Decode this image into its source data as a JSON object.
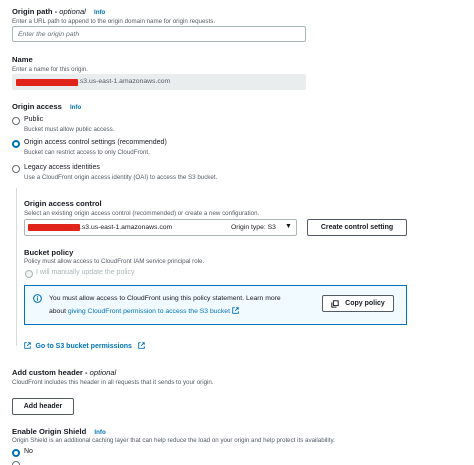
{
  "origin_path": {
    "label": "Origin path",
    "optional": "optional",
    "info": "Info",
    "description": "Enter a URL path to append to the origin domain name for origin requests.",
    "placeholder": "Enter the origin path"
  },
  "name": {
    "label": "Name",
    "description": "Enter a name for this origin.",
    "value_suffix": ".s3.us-east-1.amazonaws.com"
  },
  "origin_access": {
    "label": "Origin access",
    "info": "Info",
    "options": [
      {
        "label": "Public",
        "description": "Bucket must allow public access.",
        "selected": false
      },
      {
        "label": "Origin access control settings (recommended)",
        "description": "Bucket can restrict access to only CloudFront.",
        "selected": true
      },
      {
        "label": "Legacy access identities",
        "description": "Use a CloudFront origin access identity (OAI) to access the S3 bucket.",
        "selected": false
      }
    ]
  },
  "oac": {
    "label": "Origin access control",
    "description": "Select an existing origin access control (recommended) or create a new configuration.",
    "value_suffix": ".s3.us-east-1.amazonaws.com",
    "origin_type": "Origin type: S3",
    "create_button": "Create control setting"
  },
  "bucket_policy": {
    "label": "Bucket policy",
    "description": "Policy must allow access to CloudFront IAM service principal role.",
    "manual_option": "I will manually update the policy"
  },
  "alert": {
    "text_line1": "You must allow access to CloudFront using this policy statement. Learn more",
    "text_prefix": "about",
    "link_text": "giving CloudFront permission to access the S3 bucket",
    "copy_button": "Copy policy"
  },
  "permissions_link": "Go to S3 bucket permissions",
  "custom_header": {
    "label": "Add custom header",
    "optional": "optional",
    "description": "CloudFront includes this header in all requests that it sends to your origin.",
    "button": "Add header"
  },
  "origin_shield": {
    "label": "Enable Origin Shield",
    "info": "Info",
    "description": "Origin Shield is an additional caching layer that can help reduce the load on your origin and help protect its availability.",
    "options": [
      {
        "label": "No",
        "selected": true
      }
    ]
  }
}
